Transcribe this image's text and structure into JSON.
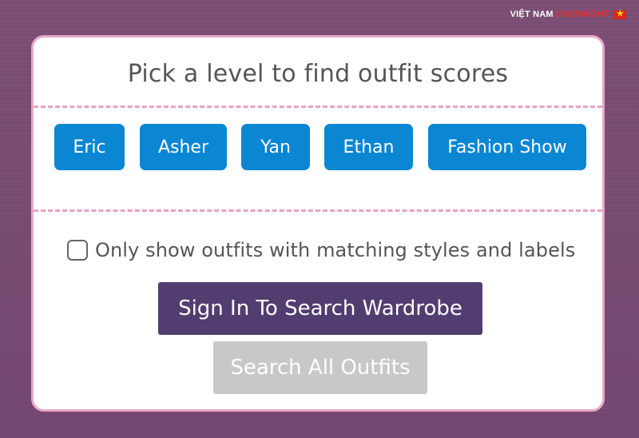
{
  "watermark": {
    "part1": "VIỆT NAM",
    "part2": "OVERNIGHT"
  },
  "title": "Pick a level to find outfit scores",
  "levels": [
    {
      "label": "Eric"
    },
    {
      "label": "Asher"
    },
    {
      "label": "Yan"
    },
    {
      "label": "Ethan"
    },
    {
      "label": "Fashion Show"
    }
  ],
  "filter": {
    "label": "Only show outfits with matching styles and labels",
    "checked": false
  },
  "buttons": {
    "sign_in": "Sign In To Search Wardrobe",
    "search_all": "Search All Outfits"
  },
  "colors": {
    "level_button": "#0a86d3",
    "sign_in_button": "#523d70",
    "search_all_button_disabled": "#c8c8c8",
    "card_border": "#e8a9c9",
    "divider": "#e7a2c6",
    "background": "#7d4f76"
  }
}
